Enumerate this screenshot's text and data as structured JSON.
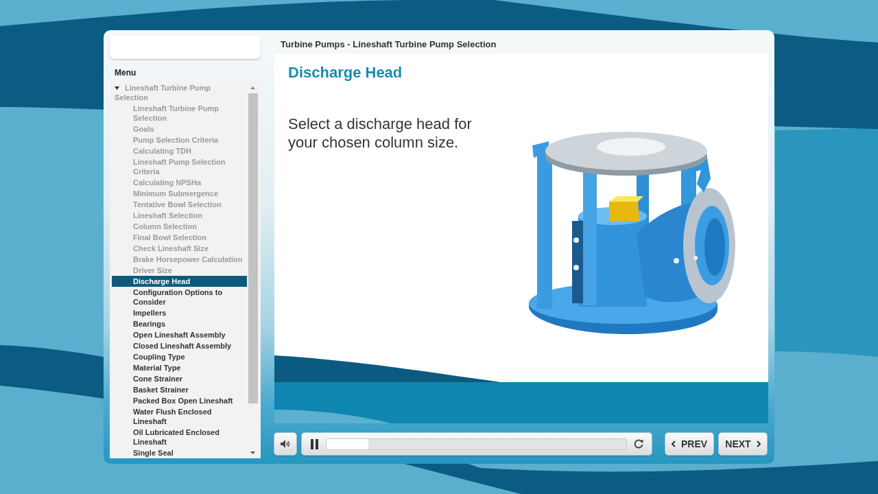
{
  "course_title": "Turbine Pumps - Lineshaft Turbine Pump Selection",
  "menu": {
    "label": "Menu",
    "items": [
      {
        "label": "Lineshaft Turbine Pump Selection",
        "expanded": true,
        "selected": false,
        "visited": true,
        "children": [
          {
            "label": "Lineshaft Turbine Pump Selection",
            "selected": false,
            "visited": true
          },
          {
            "label": "Goals",
            "selected": false,
            "visited": true
          },
          {
            "label": "Pump Selection Criteria",
            "selected": false,
            "visited": true
          },
          {
            "label": "Calculating TDH",
            "selected": false,
            "visited": true
          },
          {
            "label": "Lineshaft Pump Selection Criteria",
            "selected": false,
            "visited": true
          },
          {
            "label": "Calculating NPSHa",
            "selected": false,
            "visited": true
          },
          {
            "label": "Minimum Submergence",
            "selected": false,
            "visited": true
          },
          {
            "label": "Tentative Bowl Selection",
            "selected": false,
            "visited": true
          },
          {
            "label": "Lineshaft Selection",
            "selected": false,
            "visited": true
          },
          {
            "label": "Column Selection",
            "selected": false,
            "visited": true
          },
          {
            "label": "Final Bowl Selection",
            "selected": false,
            "visited": true
          },
          {
            "label": "Check Lineshaft Size",
            "selected": false,
            "visited": true
          },
          {
            "label": "Brake Horsepower Calculation",
            "selected": false,
            "visited": true
          },
          {
            "label": "Driver Size",
            "selected": false,
            "visited": true
          },
          {
            "label": "Discharge Head",
            "selected": true,
            "visited": false
          },
          {
            "label": "Configuration Options to Consider",
            "selected": false,
            "visited": false
          },
          {
            "label": "Impellers",
            "selected": false,
            "visited": false
          },
          {
            "label": "Bearings",
            "selected": false,
            "visited": false
          },
          {
            "label": "Open Lineshaft Assembly",
            "selected": false,
            "visited": false
          },
          {
            "label": "Closed Lineshaft Assembly",
            "selected": false,
            "visited": false
          },
          {
            "label": "Coupling Type",
            "selected": false,
            "visited": false
          },
          {
            "label": "Material Type",
            "selected": false,
            "visited": false
          },
          {
            "label": "Cone Strainer",
            "selected": false,
            "visited": false
          },
          {
            "label": "Basket Strainer",
            "selected": false,
            "visited": false
          },
          {
            "label": "Packed Box Open Lineshaft",
            "selected": false,
            "visited": false
          },
          {
            "label": "Water Flush Enclosed Lineshaft",
            "selected": false,
            "visited": false
          },
          {
            "label": "Oil Lubricated Enclosed Lineshaft",
            "selected": false,
            "visited": false
          },
          {
            "label": "Single Seal",
            "selected": false,
            "visited": false
          }
        ]
      }
    ]
  },
  "slide": {
    "heading": "Discharge Head",
    "body": "Select a discharge head for your chosen column size."
  },
  "player": {
    "playing": true,
    "progress": {
      "level": 0.14
    },
    "buttons": [
      {
        "kind": "prev",
        "label": "PREV"
      },
      {
        "kind": "next",
        "label": "NEXT"
      }
    ]
  }
}
